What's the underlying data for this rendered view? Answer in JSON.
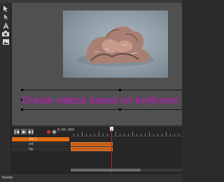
{
  "stage": {
    "caption": "Create videos based on keyframe an"
  },
  "toolbar": {
    "icons": [
      "pointer-icon",
      "select-icon",
      "text-icon",
      "camera-icon",
      "image-icon"
    ]
  },
  "timeline": {
    "time_display": "0:00.000",
    "tracks": [
      {
        "label": "Text 1"
      },
      {
        "label": "left"
      },
      {
        "label": "top"
      }
    ]
  },
  "status": {
    "text": "Ready"
  },
  "colors": {
    "caption": "#c316c3",
    "track_accent": "#e06c12",
    "playhead": "#c62020"
  }
}
